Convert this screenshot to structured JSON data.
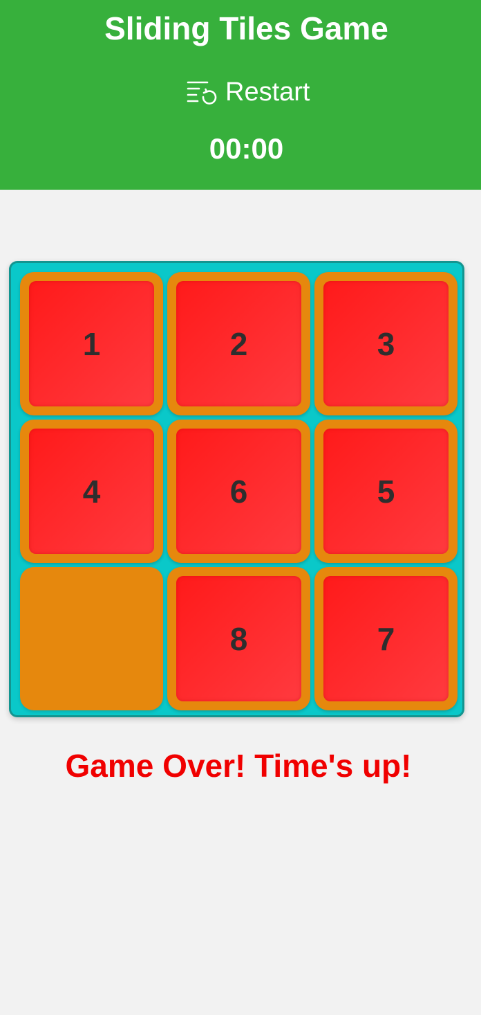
{
  "header": {
    "title": "Sliding Tiles Game",
    "restart_label": "Restart",
    "restart_icon": "restart-icon",
    "timer": "00:00"
  },
  "board": {
    "rows": 3,
    "cols": 3,
    "tiles": [
      "1",
      "2",
      "3",
      "4",
      "6",
      "5",
      "",
      "8",
      "7"
    ],
    "empty_index": 6
  },
  "message": "Game Over! Time's up!",
  "colors": {
    "header_bg": "#37b03c",
    "board_bg": "#0ac8c9",
    "board_border": "#139590",
    "tile_frame": "#e6880d",
    "tile_face": "#ff2a2a",
    "message": "#f00000"
  }
}
